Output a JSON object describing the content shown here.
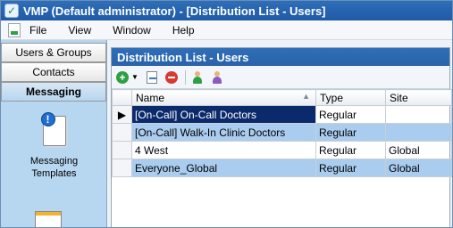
{
  "window": {
    "title": "VMP (Default administrator) - [Distribution List - Users]"
  },
  "menubar": {
    "items": [
      "File",
      "View",
      "Window",
      "Help"
    ]
  },
  "sidebar": {
    "buttons": [
      {
        "label": "Users & Groups",
        "active": false
      },
      {
        "label": "Contacts",
        "active": false
      },
      {
        "label": "Messaging",
        "active": true
      }
    ],
    "tile_label_line1": "Messaging",
    "tile_label_line2": "Templates"
  },
  "content": {
    "header": "Distribution List - Users",
    "columns": [
      "Name",
      "Type",
      "Site"
    ],
    "rows": [
      {
        "name": "[On-Call] On-Call Doctors",
        "type": "Regular",
        "site": ""
      },
      {
        "name": "[On-Call] Walk-In Clinic Doctors",
        "type": "Regular",
        "site": ""
      },
      {
        "name": "4 West",
        "type": "Regular",
        "site": "Global"
      },
      {
        "name": "Everyone_Global",
        "type": "Regular",
        "site": "Global"
      }
    ]
  },
  "colors": {
    "title_bar": "#1f5aa6",
    "sidebar": "#b7d6f0",
    "selected_row": "#0b2a6b",
    "alt_row": "#a9ccef"
  }
}
